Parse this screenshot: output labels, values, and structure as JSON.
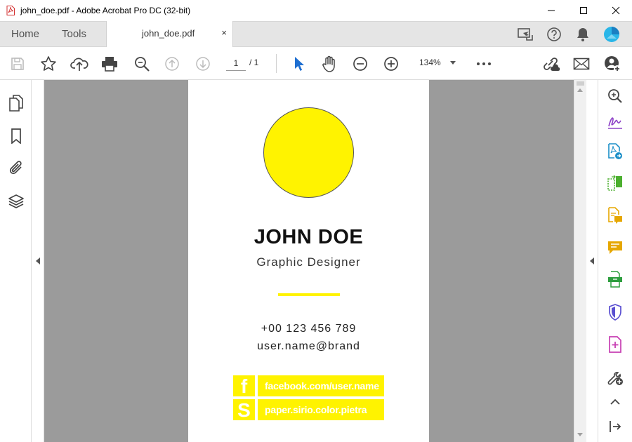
{
  "window": {
    "title": "john_doe.pdf - Adobe Acrobat Pro DC (32-bit)",
    "controls": [
      "minimize-icon",
      "maximize-icon",
      "close-icon"
    ]
  },
  "nav_tabs": {
    "home": "Home",
    "tools": "Tools"
  },
  "doc_tab": {
    "label": "john_doe.pdf",
    "close": "×"
  },
  "toolbar": {
    "current_page": "1",
    "page_total": "/ 1",
    "zoom": "134%",
    "icons": [
      "save-icon",
      "star-icon",
      "cloud-upload-icon",
      "print-icon",
      "zoom-search-icon",
      "page-up-icon",
      "page-down-icon",
      "select-cursor-icon",
      "hand-icon",
      "zoom-out-icon",
      "zoom-in-icon",
      "more-icon",
      "share-link-icon",
      "mail-icon",
      "add-user-icon"
    ]
  },
  "left_panel": [
    "pages-icon",
    "bookmark-icon",
    "attachment-icon",
    "layers-icon"
  ],
  "right_panel": [
    "zoom-search-icon",
    "fill-sign-icon",
    "export-pdf-icon",
    "organize-pages-icon",
    "comment-file-icon",
    "comment-icon",
    "scan-icon",
    "protect-icon",
    "create-pdf-icon",
    "more-tools-icon",
    "collapse-up-icon",
    "exit-panel-icon"
  ],
  "card": {
    "name": "JOHN DOE",
    "role": "Graphic Designer",
    "phone": "+00 123 456 789",
    "email": "user.name@brand",
    "social": [
      {
        "icon": "f",
        "label": "facebook.com/user.name"
      },
      {
        "icon": "S",
        "label": "paper.sirio.color.pietra"
      }
    ],
    "accent_color": "#fff300"
  }
}
